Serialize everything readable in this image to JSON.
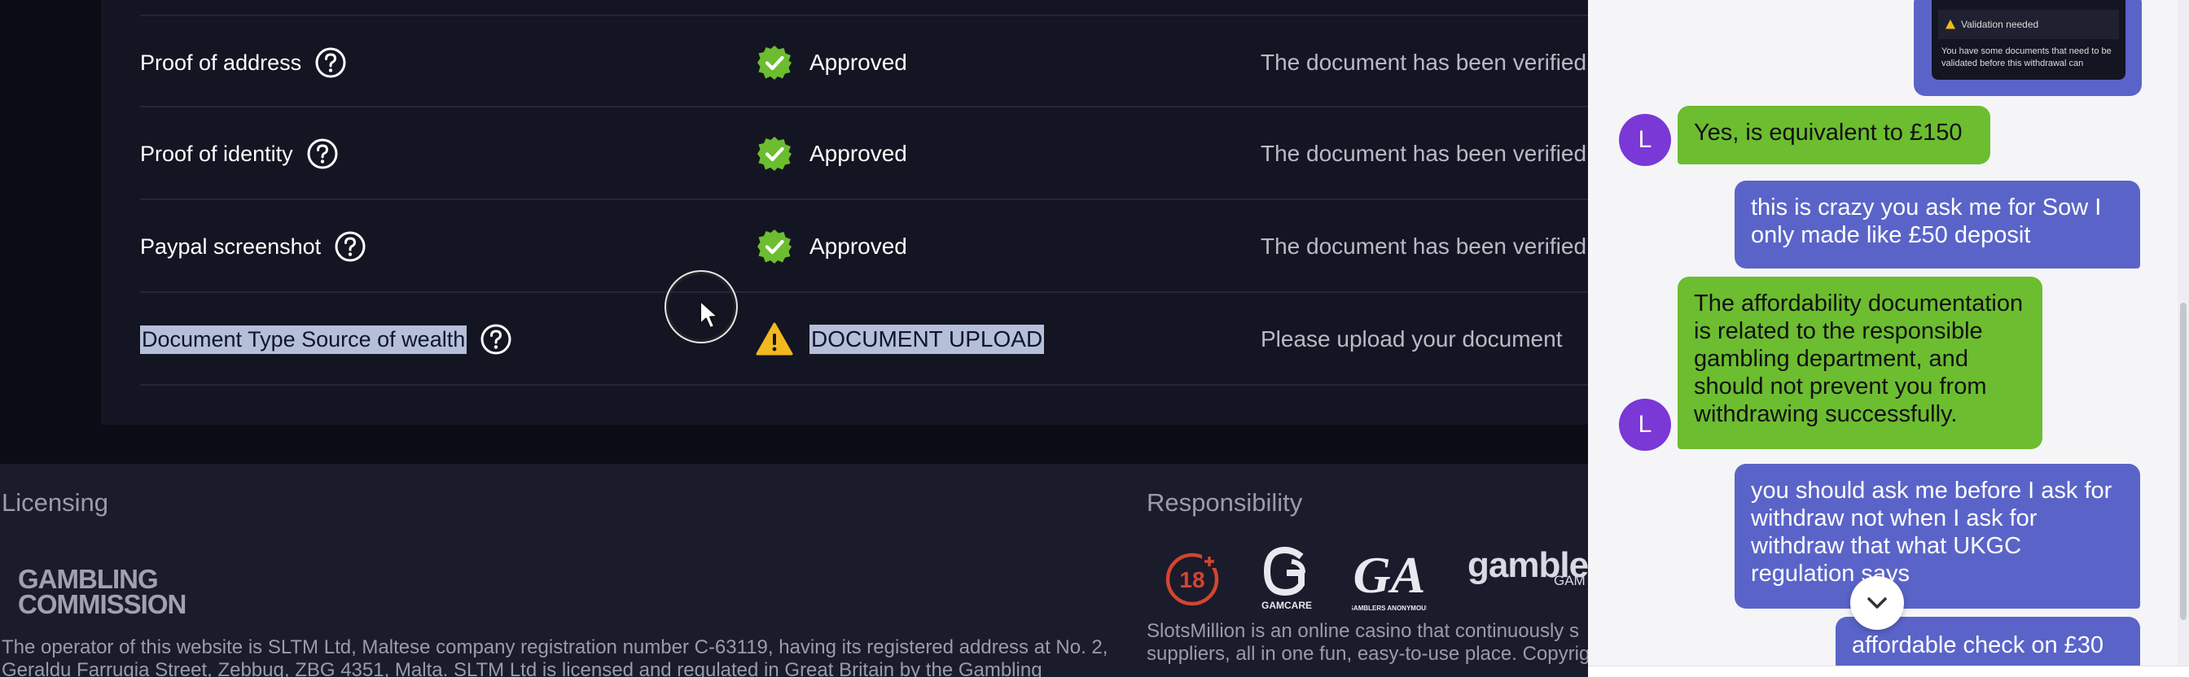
{
  "documents": {
    "rows": [
      {
        "name": "Proof of address",
        "status": "Approved",
        "description": "The document has been verified"
      },
      {
        "name": "Proof of identity",
        "status": "Approved",
        "description": "The document has been verified"
      },
      {
        "name": "Paypal screenshot",
        "status": "Approved",
        "description": "The document has been verified"
      },
      {
        "name": "Document Type Source of wealth",
        "status": "DOCUMENT UPLOAD",
        "description": "Please upload your document"
      }
    ]
  },
  "footer": {
    "licensing": {
      "heading": "Licensing",
      "logo_line1": "GAMBLING",
      "logo_line2": "COMMISSION",
      "text_line1": "The operator of this website is SLTM Ltd, Maltese company registration number C-63119, having its registered address at No. 2,",
      "text_line2": "Geraldu Farrugia Street, Zebbug, ZBG 4351, Malta. SLTM Ltd is licensed and regulated in Great Britain by the Gambling"
    },
    "responsibility": {
      "heading": "Responsibility",
      "age_badge": "18",
      "gamcare_label": "GAMCARE",
      "ga_label": "GAMBLERS ANONYMOUS",
      "gamble_text": "gamble",
      "gamble_sub": "GAM",
      "text_line1": "SlotsMillion is an online casino that continuously s",
      "text_line2": "suppliers, all in one fun, easy-to-use place. Copyrig"
    }
  },
  "chat": {
    "image_attachment": {
      "banner": "Validation needed",
      "text": "You have some documents that need to be validated before this withdrawal can"
    },
    "messages": [
      {
        "sender": "agent",
        "avatar": "L",
        "text": "Yes, is equivalent to £150"
      },
      {
        "sender": "user",
        "text": "this is crazy you ask me for Sow I only made like £50 deposit"
      },
      {
        "sender": "agent",
        "avatar": "L",
        "text": "The affordability documentation is related to the responsible gambling department, and should not prevent you from withdrawing successfully."
      },
      {
        "sender": "user",
        "text": "you should ask me before I ask for withdraw not when I ask for withdraw that what UKGC regulation says"
      },
      {
        "sender": "user",
        "text": "affordable check on £30"
      }
    ]
  },
  "colors": {
    "approved_green": "#6cbd30",
    "warning_yellow": "#f2b81f",
    "user_bubble": "#5a64c8",
    "agent_bubble": "#6cbd30",
    "avatar": "#7a38d6"
  },
  "icons": {
    "help": "question-circle-icon",
    "approved": "check-badge-icon",
    "warning": "warning-triangle-icon",
    "scroll_down": "chevron-down-icon",
    "cursor": "mouse-pointer-icon"
  }
}
